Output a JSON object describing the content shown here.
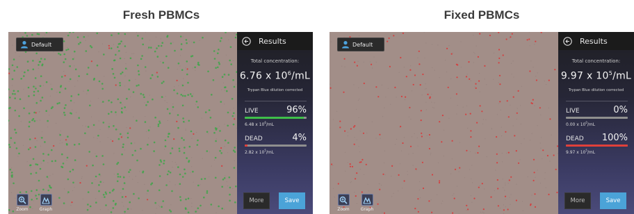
{
  "headings": {
    "left": "Fresh PBMCs",
    "right": "Fixed PBMCs"
  },
  "colors": {
    "live": "#3fbf4a",
    "dead": "#e0403a",
    "save": "#4ba3d8",
    "image_bg": "#a28e88"
  },
  "icons": [
    "person-icon",
    "back-arrow-icon",
    "zoom-icon",
    "graph-icon"
  ],
  "left": {
    "profile": "Default",
    "tools": {
      "zoom": "Zoom",
      "graph": "Graph"
    },
    "results": {
      "title": "Results",
      "total_label": "Total concentration:",
      "conc_base": "6.76 x 10",
      "conc_exp": "6",
      "conc_unit": "/mL",
      "note": "Trypan Blue dilution corrected",
      "live_label": "LIVE",
      "live_pct": "96%",
      "live_fraction": 0.96,
      "live_count_base": "6.48 x 10",
      "live_count_exp": "6",
      "live_count_unit": "/mL",
      "dead_label": "DEAD",
      "dead_pct": "4%",
      "dead_fraction": 0.04,
      "dead_count_base": "2.82 x 10",
      "dead_count_exp": "5",
      "dead_count_unit": "/mL",
      "more": "More",
      "save": "Save"
    }
  },
  "right": {
    "profile": "Default",
    "tools": {
      "zoom": "Zoom",
      "graph": "Graph"
    },
    "results": {
      "title": "Results",
      "total_label": "Total concentration:",
      "conc_base": "9.97 x 10",
      "conc_exp": "5",
      "conc_unit": "/mL",
      "note": "Trypan Blue dilution corrected",
      "live_label": "LIVE",
      "live_pct": "0%",
      "live_fraction": 0.0,
      "live_count_base": "0.00 x 10",
      "live_count_exp": "0",
      "live_count_unit": "/mL",
      "dead_label": "DEAD",
      "dead_pct": "100%",
      "dead_fraction": 1.0,
      "dead_count_base": "9.97 x 10",
      "dead_count_exp": "5",
      "dead_count_unit": "/mL",
      "more": "More",
      "save": "Save"
    }
  }
}
